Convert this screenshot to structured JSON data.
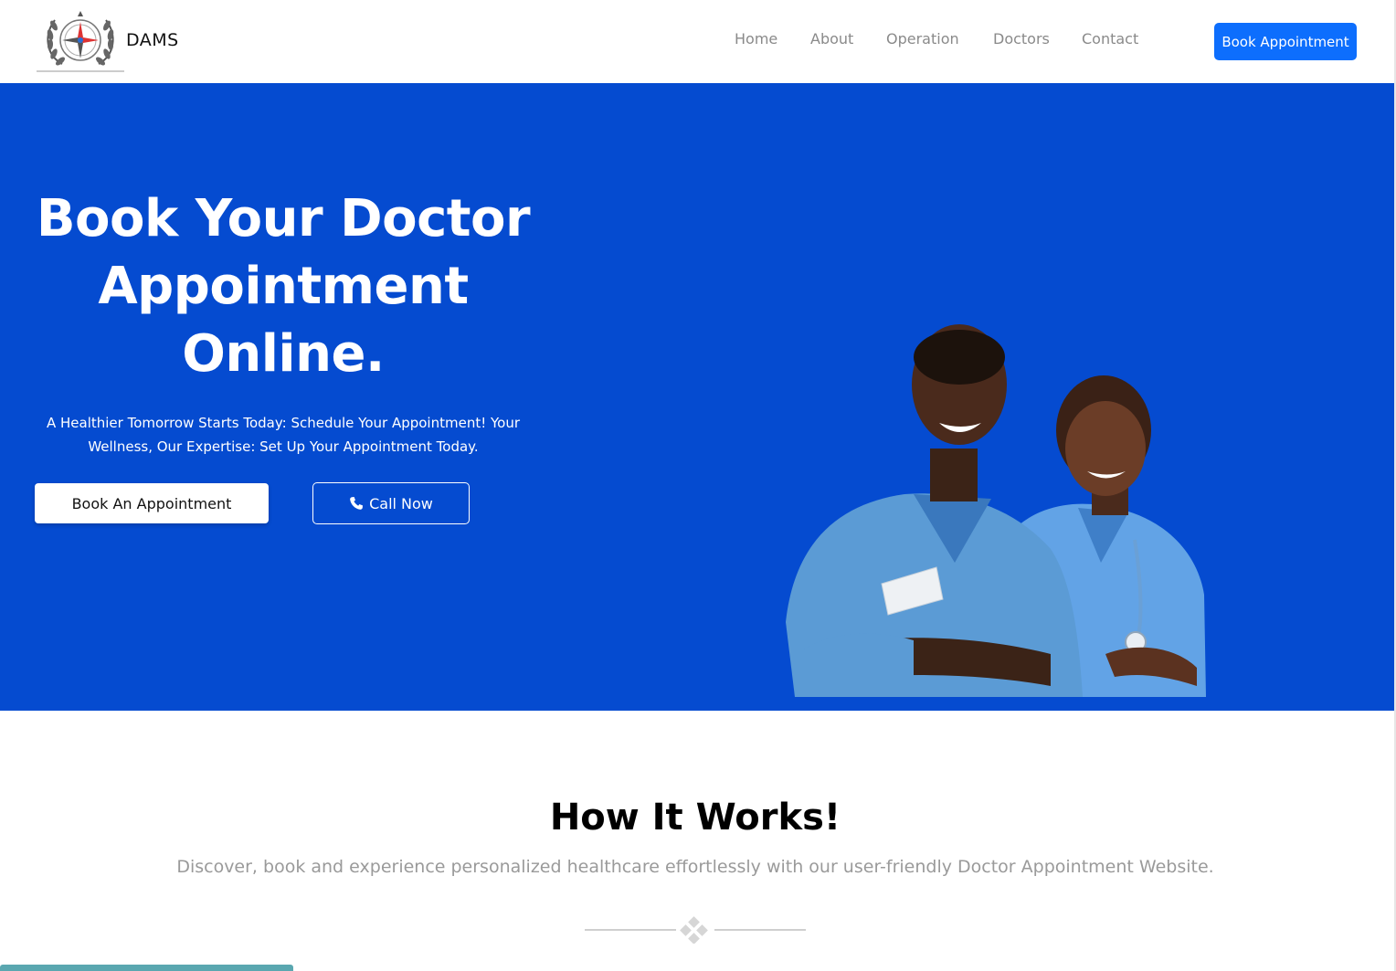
{
  "brand": {
    "name": "DAMS"
  },
  "nav": {
    "links": [
      "Home",
      "About",
      "Operation",
      "Doctors",
      "Contact"
    ],
    "cta": "Book Appointment"
  },
  "hero": {
    "title_line1": "Book Your Doctor",
    "title_line2": "Appointment",
    "title_line3": "Online.",
    "subtitle": "A Healthier Tomorrow Starts Today: Schedule Your Appointment! Your Wellness, Our Expertise: Set Up Your Appointment Today.",
    "book_button": "Book An Appointment",
    "call_button": "Call Now"
  },
  "how": {
    "title": "How It Works!",
    "subtitle": "Discover, book and experience personalized healthcare effortlessly with our user-friendly Doctor Appointment Website."
  },
  "colors": {
    "hero_bg": "#054bd0",
    "primary": "#0d6efd",
    "scrub": "#5b9bd5",
    "muted_text": "#9a9a9a"
  },
  "icons": {
    "logo": "laurel-compass-logo",
    "call": "phone-icon",
    "divider": "diamond-cluster-icon"
  }
}
